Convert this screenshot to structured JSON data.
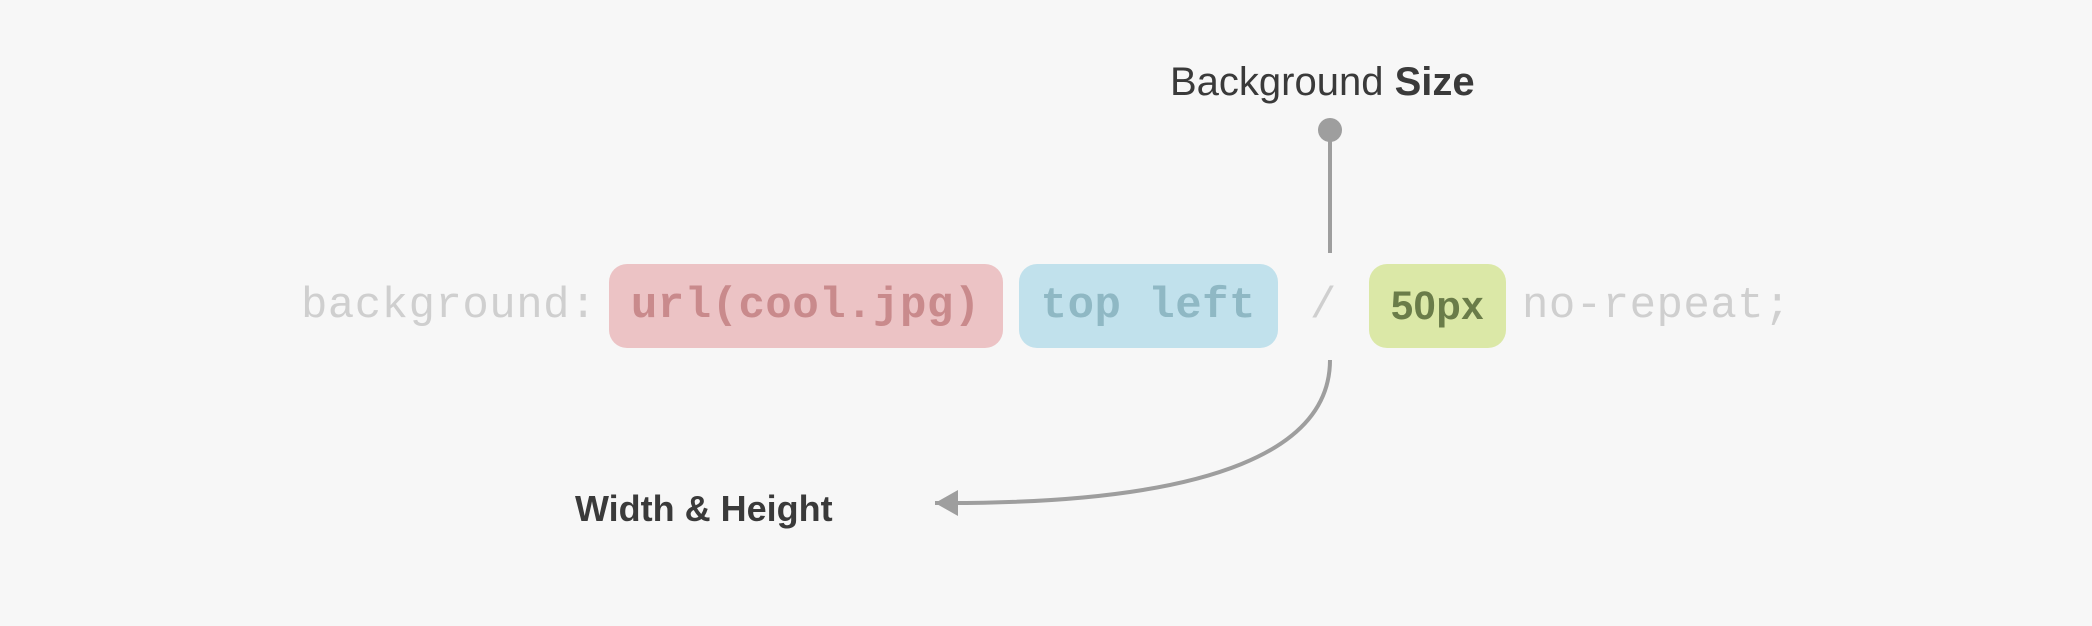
{
  "labels": {
    "top_prefix": "Background ",
    "top_bold": "Size",
    "bottom": "Width & Height"
  },
  "code": {
    "property": "background:",
    "url": "url(cool.jpg)",
    "position": "top left",
    "slash": "/",
    "size": "50px",
    "repeat": "no-repeat;"
  }
}
